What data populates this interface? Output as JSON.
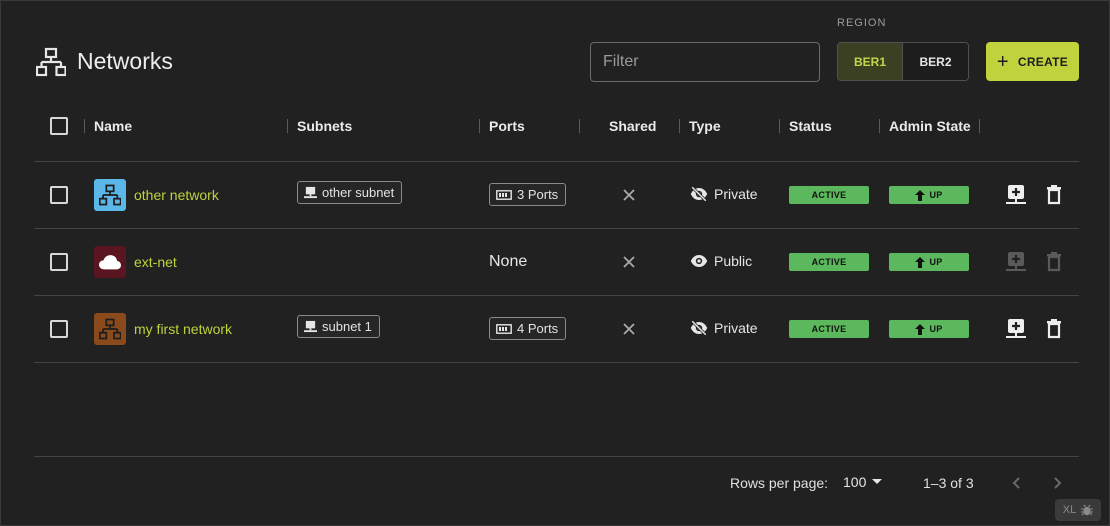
{
  "header": {
    "title": "Networks",
    "title_icon": "network-tree-icon",
    "filter_placeholder": "Filter",
    "region_label": "REGION",
    "regions": [
      {
        "label": "BER1",
        "selected": true
      },
      {
        "label": "BER2",
        "selected": false
      }
    ],
    "create_label": "CREATE"
  },
  "columns": [
    "Name",
    "Subnets",
    "Ports",
    "Shared",
    "Type",
    "Status",
    "Admin State"
  ],
  "rows": [
    {
      "name": "other network",
      "icon": "network-tree-icon",
      "icon_color": "#5bb7e8",
      "subnet": "other subnet",
      "ports": "3 Ports",
      "shared": false,
      "type": "Private",
      "type_icon": "eye-off-icon",
      "status": "ACTIVE",
      "admin_state": "UP",
      "actions_enabled": true
    },
    {
      "name": "ext-net",
      "icon": "cloud-icon",
      "icon_color": "#5a1520",
      "subnet": "",
      "ports": "None",
      "shared": false,
      "type": "Public",
      "type_icon": "eye-icon",
      "status": "ACTIVE",
      "admin_state": "UP",
      "actions_enabled": false
    },
    {
      "name": "my first network",
      "icon": "network-tree-icon",
      "icon_color": "#8a4a1c",
      "subnet": "subnet 1",
      "ports": "4 Ports",
      "shared": false,
      "type": "Private",
      "type_icon": "eye-off-icon",
      "status": "ACTIVE",
      "admin_state": "UP",
      "actions_enabled": true
    }
  ],
  "footer": {
    "rows_per_page_label": "Rows per page:",
    "rows_per_page_value": "100",
    "range": "1–3 of 3"
  },
  "badge": {
    "label": "XL"
  },
  "colors": {
    "accent": "#c0d23c",
    "status_green": "#5cb85c",
    "background": "#212121"
  }
}
